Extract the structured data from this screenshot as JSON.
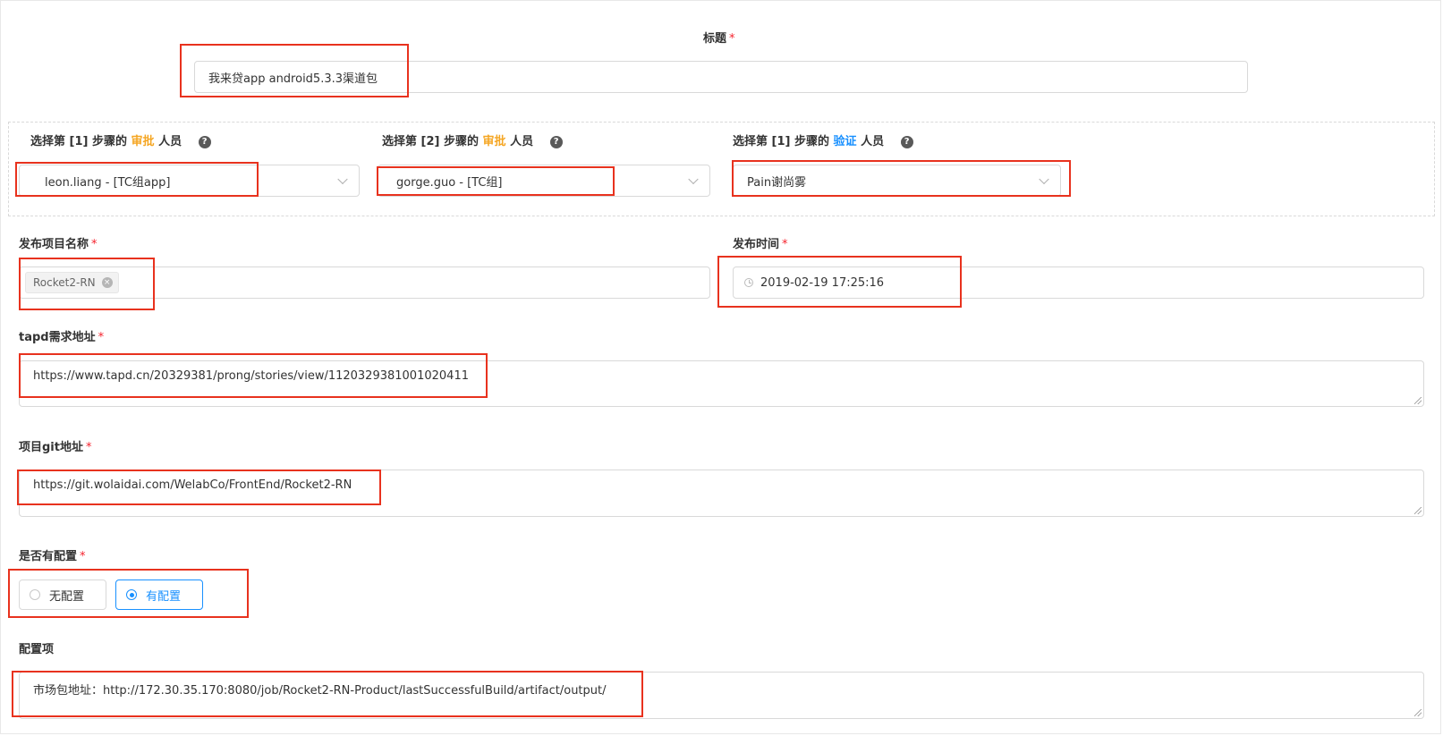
{
  "title_field": {
    "label": "标题",
    "required_mark": "*",
    "value": "我来贷app android5.3.3渠道包"
  },
  "approvers": [
    {
      "label_prefix": "选择第 [1] 步骤的",
      "label_role": "审批",
      "label_suffix": "人员",
      "role_color": "#f5a623",
      "help_icon": "question-circle-icon",
      "value": "leon.liang - [TC组app]"
    },
    {
      "label_prefix": "选择第 [2] 步骤的",
      "label_role": "审批",
      "label_suffix": "人员",
      "role_color": "#f5a623",
      "help_icon": "question-circle-icon",
      "value": "gorge.guo - [TC组]"
    },
    {
      "label_prefix": "选择第 [1] 步骤的",
      "label_role": "验证",
      "label_suffix": "人员",
      "role_color": "#1890ff",
      "help_icon": "question-circle-icon",
      "value": "Pain谢尚雾"
    }
  ],
  "project_name": {
    "label": "发布项目名称",
    "required_mark": "*",
    "tag": "Rocket2-RN",
    "tag_close_icon": "close-circle-icon"
  },
  "release_time": {
    "label": "发布时间",
    "required_mark": "*",
    "icon": "clock-icon",
    "value": "2019-02-19 17:25:16"
  },
  "tapd_url": {
    "label": "tapd需求地址",
    "required_mark": "*",
    "value": "https://www.tapd.cn/20329381/prong/stories/view/1120329381001020411"
  },
  "git_url": {
    "label": "项目git地址",
    "required_mark": "*",
    "value": "https://git.wolaidai.com/WelabCo/FrontEnd/Rocket2-RN"
  },
  "has_config": {
    "label": "是否有配置",
    "required_mark": "*",
    "options": [
      "无配置",
      "有配置"
    ],
    "selected": "有配置"
  },
  "config_items": {
    "label": "配置项",
    "value": "市场包地址：http://172.30.35.170:8080/job/Rocket2-RN-Product/lastSuccessfulBuild/artifact/output/"
  },
  "colors": {
    "highlight_box": "#e8321e",
    "required": "#f5222d",
    "primary": "#1890ff"
  }
}
